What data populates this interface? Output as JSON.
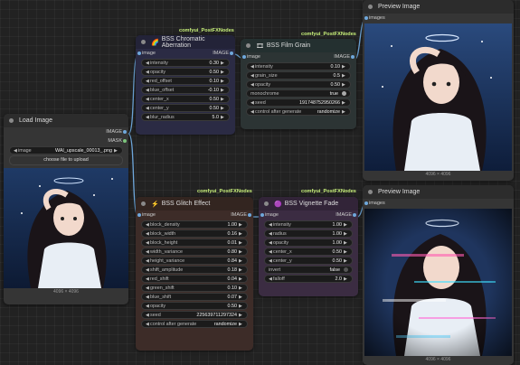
{
  "tags": {
    "chromatic": "comfyui_PostFXNodes",
    "film": "comfyui_PostFXNodes",
    "glitch": "comfyui_PostFXNodes",
    "vignette": "comfyui_PostFXNodes"
  },
  "load_image": {
    "title": "Load Image",
    "out_image": "IMAGE",
    "out_mask": "MASK",
    "image_label": "image",
    "image_value": "WAI_upscale_00013_.png",
    "upload_label": "choose file to upload",
    "dims": "4096 × 4096"
  },
  "chromatic": {
    "title": "BSS Chromatic Aberration",
    "in_label": "image",
    "out_label": "IMAGE",
    "widgets": [
      {
        "label": "intensity",
        "value": "0.30"
      },
      {
        "label": "opacity",
        "value": "0.50"
      },
      {
        "label": "red_offset",
        "value": "0.10"
      },
      {
        "label": "blue_offset",
        "value": "-0.10"
      },
      {
        "label": "center_x",
        "value": "0.50"
      },
      {
        "label": "center_y",
        "value": "0.50"
      },
      {
        "label": "blur_radius",
        "value": "5.0"
      }
    ]
  },
  "film": {
    "title": "BSS Film Grain",
    "in_label": "image",
    "out_label": "IMAGE",
    "widgets": [
      {
        "label": "intensity",
        "value": "0.10"
      },
      {
        "label": "grain_size",
        "value": "0.5"
      },
      {
        "label": "opacity",
        "value": "0.50"
      },
      {
        "label": "monochrome",
        "value": "true"
      },
      {
        "label": "seed",
        "value": "191748752950266"
      },
      {
        "label": "control after generate",
        "value": "randomize"
      }
    ]
  },
  "glitch": {
    "title": "BSS Glitch Effect",
    "in_label": "image",
    "out_label": "IMAGE",
    "widgets": [
      {
        "label": "block_density",
        "value": "1.00"
      },
      {
        "label": "block_width",
        "value": "0.16"
      },
      {
        "label": "block_height",
        "value": "0.01"
      },
      {
        "label": "width_variance",
        "value": "0.80"
      },
      {
        "label": "height_variance",
        "value": "0.84"
      },
      {
        "label": "shift_amplitude",
        "value": "0.18"
      },
      {
        "label": "red_shift",
        "value": "0.04"
      },
      {
        "label": "green_shift",
        "value": "0.10"
      },
      {
        "label": "blue_shift",
        "value": "0.07"
      },
      {
        "label": "opacity",
        "value": "0.50"
      },
      {
        "label": "seed",
        "value": "225639711297324"
      },
      {
        "label": "control after generate",
        "value": "randomize"
      }
    ]
  },
  "vignette": {
    "title": "BSS Vignette Fade",
    "in_label": "image",
    "out_label": "IMAGE",
    "widgets": [
      {
        "label": "intensity",
        "value": "1.00"
      },
      {
        "label": "radius",
        "value": "1.00"
      },
      {
        "label": "opacity",
        "value": "1.00"
      },
      {
        "label": "center_x",
        "value": "0.50"
      },
      {
        "label": "center_y",
        "value": "0.50"
      },
      {
        "label": "invert",
        "value": "false"
      },
      {
        "label": "falloff",
        "value": "2.0"
      }
    ]
  },
  "preview1": {
    "title": "Preview Image",
    "in_label": "images",
    "dims": "4096 × 4096"
  },
  "preview2": {
    "title": "Preview Image",
    "in_label": "images",
    "dims": "4096 × 4096"
  },
  "colors": {
    "link_image": "#6fa8dc",
    "chromatic_bg": "#2b2b44",
    "film_bg": "#2c3434",
    "glitch_bg": "#3d2c28",
    "vignette_bg": "#3b2c42"
  }
}
